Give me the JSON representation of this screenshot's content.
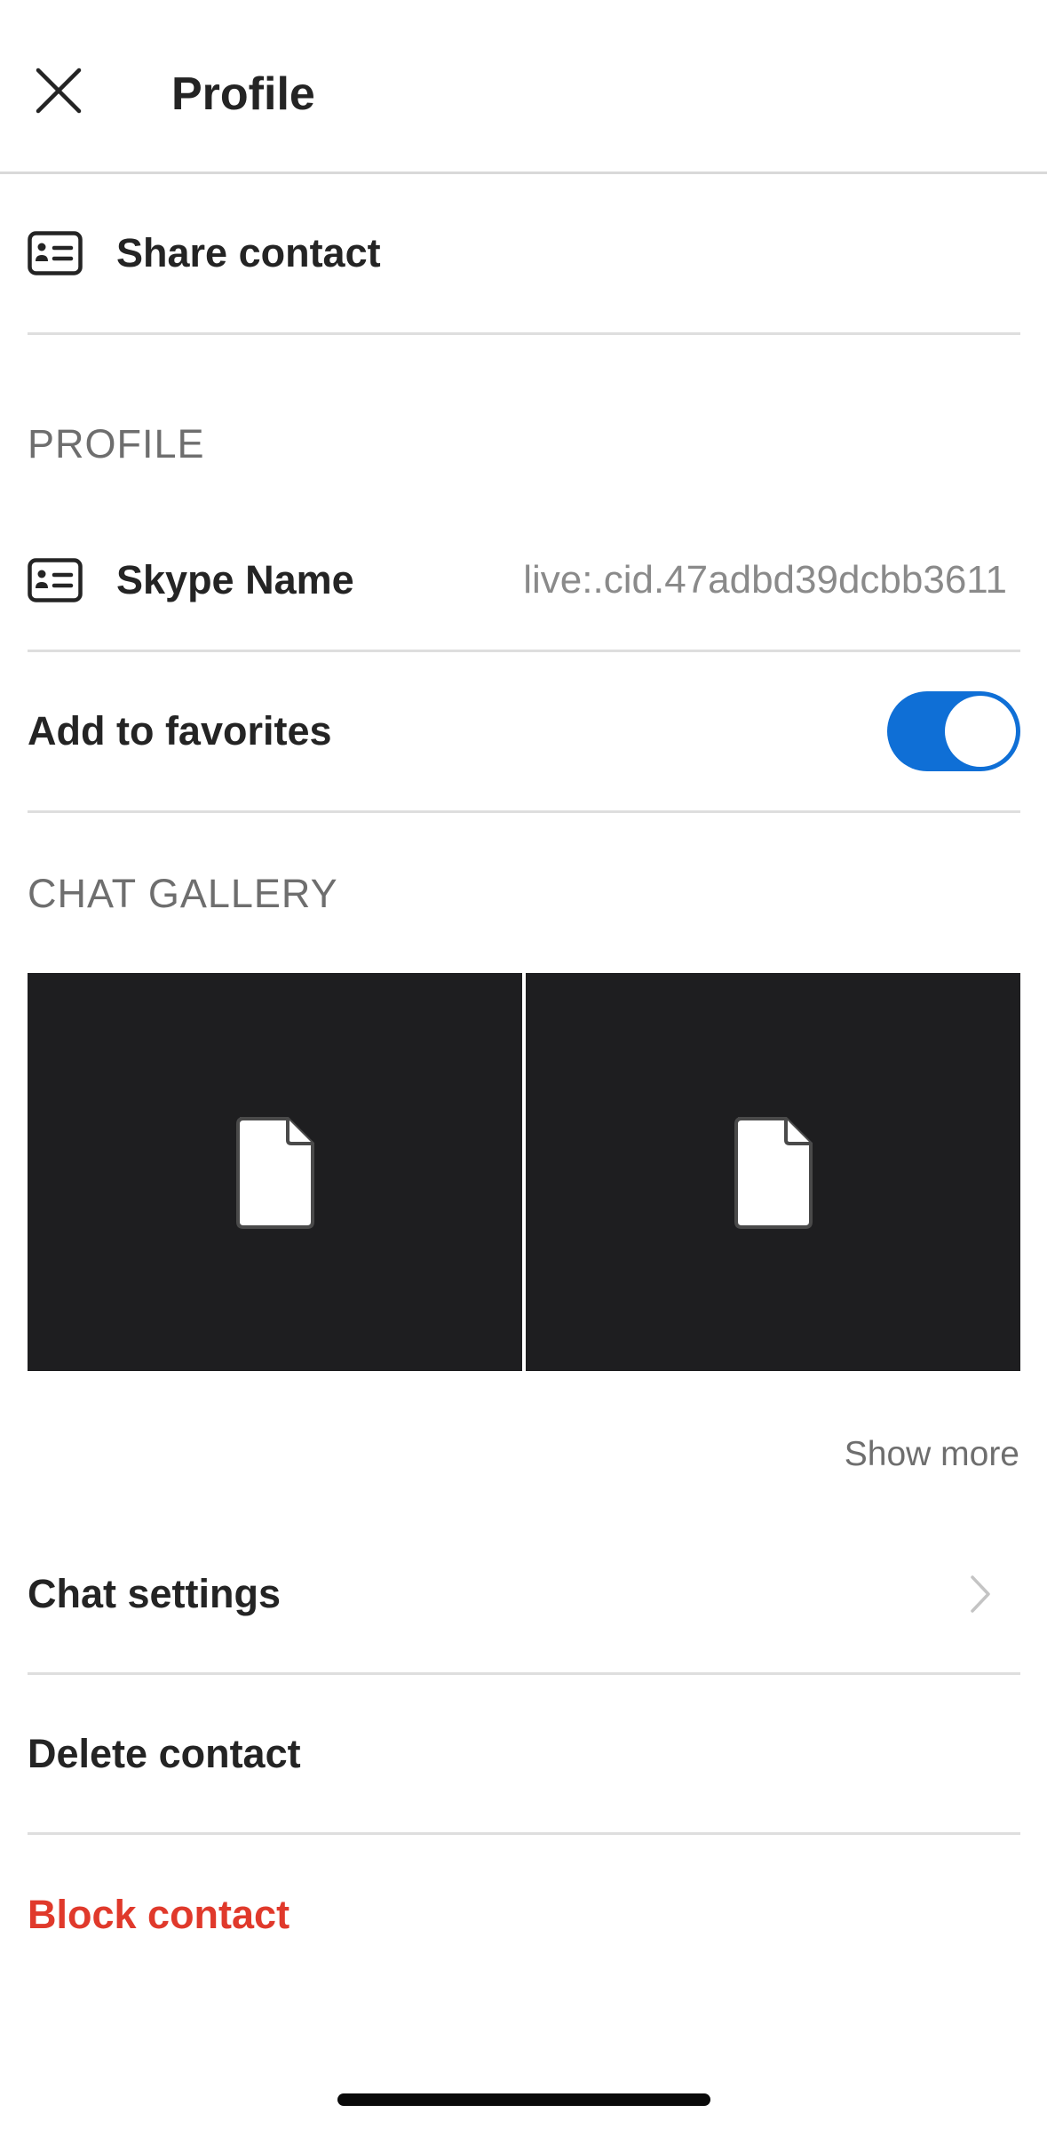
{
  "header": {
    "title": "Profile",
    "close_icon": "close-icon"
  },
  "share": {
    "label": "Share contact",
    "icon": "contact-card-icon"
  },
  "profile_section": {
    "title": "PROFILE",
    "skype_name": {
      "label": "Skype Name",
      "value": "live:.cid.47adbd39dcbb3611",
      "icon": "contact-card-icon"
    }
  },
  "favorites": {
    "label": "Add to favorites",
    "enabled": true,
    "accent": "#0f6fd6"
  },
  "gallery": {
    "title": "CHAT GALLERY",
    "items": [
      {
        "icon": "document-icon"
      },
      {
        "icon": "document-icon"
      }
    ],
    "show_more": "Show more"
  },
  "chat_settings": {
    "label": "Chat settings",
    "icon": "chevron-right-icon"
  },
  "delete_contact": {
    "label": "Delete contact"
  },
  "block_contact": {
    "label": "Block contact",
    "color": "#e0392b"
  }
}
